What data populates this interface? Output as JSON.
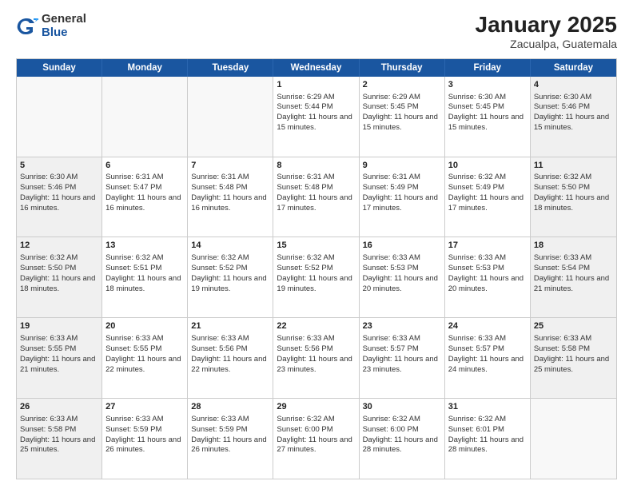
{
  "logo": {
    "general": "General",
    "blue": "Blue"
  },
  "title": "January 2025",
  "subtitle": "Zacualpa, Guatemala",
  "weekdays": [
    "Sunday",
    "Monday",
    "Tuesday",
    "Wednesday",
    "Thursday",
    "Friday",
    "Saturday"
  ],
  "weeks": [
    [
      {
        "day": "",
        "empty": true
      },
      {
        "day": "",
        "empty": true
      },
      {
        "day": "",
        "empty": true
      },
      {
        "day": "1",
        "sunrise": "Sunrise: 6:29 AM",
        "sunset": "Sunset: 5:44 PM",
        "daylight": "Daylight: 11 hours and 15 minutes."
      },
      {
        "day": "2",
        "sunrise": "Sunrise: 6:29 AM",
        "sunset": "Sunset: 5:45 PM",
        "daylight": "Daylight: 11 hours and 15 minutes."
      },
      {
        "day": "3",
        "sunrise": "Sunrise: 6:30 AM",
        "sunset": "Sunset: 5:45 PM",
        "daylight": "Daylight: 11 hours and 15 minutes."
      },
      {
        "day": "4",
        "sunrise": "Sunrise: 6:30 AM",
        "sunset": "Sunset: 5:46 PM",
        "daylight": "Daylight: 11 hours and 15 minutes."
      }
    ],
    [
      {
        "day": "5",
        "sunrise": "Sunrise: 6:30 AM",
        "sunset": "Sunset: 5:46 PM",
        "daylight": "Daylight: 11 hours and 16 minutes."
      },
      {
        "day": "6",
        "sunrise": "Sunrise: 6:31 AM",
        "sunset": "Sunset: 5:47 PM",
        "daylight": "Daylight: 11 hours and 16 minutes."
      },
      {
        "day": "7",
        "sunrise": "Sunrise: 6:31 AM",
        "sunset": "Sunset: 5:48 PM",
        "daylight": "Daylight: 11 hours and 16 minutes."
      },
      {
        "day": "8",
        "sunrise": "Sunrise: 6:31 AM",
        "sunset": "Sunset: 5:48 PM",
        "daylight": "Daylight: 11 hours and 17 minutes."
      },
      {
        "day": "9",
        "sunrise": "Sunrise: 6:31 AM",
        "sunset": "Sunset: 5:49 PM",
        "daylight": "Daylight: 11 hours and 17 minutes."
      },
      {
        "day": "10",
        "sunrise": "Sunrise: 6:32 AM",
        "sunset": "Sunset: 5:49 PM",
        "daylight": "Daylight: 11 hours and 17 minutes."
      },
      {
        "day": "11",
        "sunrise": "Sunrise: 6:32 AM",
        "sunset": "Sunset: 5:50 PM",
        "daylight": "Daylight: 11 hours and 18 minutes."
      }
    ],
    [
      {
        "day": "12",
        "sunrise": "Sunrise: 6:32 AM",
        "sunset": "Sunset: 5:50 PM",
        "daylight": "Daylight: 11 hours and 18 minutes."
      },
      {
        "day": "13",
        "sunrise": "Sunrise: 6:32 AM",
        "sunset": "Sunset: 5:51 PM",
        "daylight": "Daylight: 11 hours and 18 minutes."
      },
      {
        "day": "14",
        "sunrise": "Sunrise: 6:32 AM",
        "sunset": "Sunset: 5:52 PM",
        "daylight": "Daylight: 11 hours and 19 minutes."
      },
      {
        "day": "15",
        "sunrise": "Sunrise: 6:32 AM",
        "sunset": "Sunset: 5:52 PM",
        "daylight": "Daylight: 11 hours and 19 minutes."
      },
      {
        "day": "16",
        "sunrise": "Sunrise: 6:33 AM",
        "sunset": "Sunset: 5:53 PM",
        "daylight": "Daylight: 11 hours and 20 minutes."
      },
      {
        "day": "17",
        "sunrise": "Sunrise: 6:33 AM",
        "sunset": "Sunset: 5:53 PM",
        "daylight": "Daylight: 11 hours and 20 minutes."
      },
      {
        "day": "18",
        "sunrise": "Sunrise: 6:33 AM",
        "sunset": "Sunset: 5:54 PM",
        "daylight": "Daylight: 11 hours and 21 minutes."
      }
    ],
    [
      {
        "day": "19",
        "sunrise": "Sunrise: 6:33 AM",
        "sunset": "Sunset: 5:55 PM",
        "daylight": "Daylight: 11 hours and 21 minutes."
      },
      {
        "day": "20",
        "sunrise": "Sunrise: 6:33 AM",
        "sunset": "Sunset: 5:55 PM",
        "daylight": "Daylight: 11 hours and 22 minutes."
      },
      {
        "day": "21",
        "sunrise": "Sunrise: 6:33 AM",
        "sunset": "Sunset: 5:56 PM",
        "daylight": "Daylight: 11 hours and 22 minutes."
      },
      {
        "day": "22",
        "sunrise": "Sunrise: 6:33 AM",
        "sunset": "Sunset: 5:56 PM",
        "daylight": "Daylight: 11 hours and 23 minutes."
      },
      {
        "day": "23",
        "sunrise": "Sunrise: 6:33 AM",
        "sunset": "Sunset: 5:57 PM",
        "daylight": "Daylight: 11 hours and 23 minutes."
      },
      {
        "day": "24",
        "sunrise": "Sunrise: 6:33 AM",
        "sunset": "Sunset: 5:57 PM",
        "daylight": "Daylight: 11 hours and 24 minutes."
      },
      {
        "day": "25",
        "sunrise": "Sunrise: 6:33 AM",
        "sunset": "Sunset: 5:58 PM",
        "daylight": "Daylight: 11 hours and 25 minutes."
      }
    ],
    [
      {
        "day": "26",
        "sunrise": "Sunrise: 6:33 AM",
        "sunset": "Sunset: 5:58 PM",
        "daylight": "Daylight: 11 hours and 25 minutes."
      },
      {
        "day": "27",
        "sunrise": "Sunrise: 6:33 AM",
        "sunset": "Sunset: 5:59 PM",
        "daylight": "Daylight: 11 hours and 26 minutes."
      },
      {
        "day": "28",
        "sunrise": "Sunrise: 6:33 AM",
        "sunset": "Sunset: 5:59 PM",
        "daylight": "Daylight: 11 hours and 26 minutes."
      },
      {
        "day": "29",
        "sunrise": "Sunrise: 6:32 AM",
        "sunset": "Sunset: 6:00 PM",
        "daylight": "Daylight: 11 hours and 27 minutes."
      },
      {
        "day": "30",
        "sunrise": "Sunrise: 6:32 AM",
        "sunset": "Sunset: 6:00 PM",
        "daylight": "Daylight: 11 hours and 28 minutes."
      },
      {
        "day": "31",
        "sunrise": "Sunrise: 6:32 AM",
        "sunset": "Sunset: 6:01 PM",
        "daylight": "Daylight: 11 hours and 28 minutes."
      },
      {
        "day": "",
        "empty": true
      }
    ]
  ]
}
